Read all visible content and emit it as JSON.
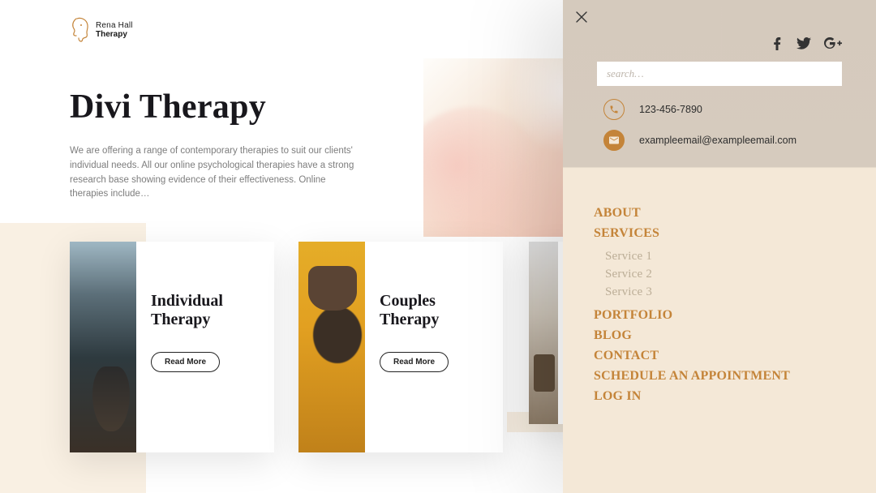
{
  "logo": {
    "name": "Rena Hall",
    "sub": "Therapy"
  },
  "hero": {
    "title": "Divi Therapy",
    "intro": "We are offering a range of contemporary therapies to suit our clients' individual needs. All our online psychological therapies have a strong research base showing evidence of their effectiveness. Online therapies include…"
  },
  "cards": [
    {
      "title": "Individual Therapy",
      "cta": "Read More"
    },
    {
      "title": "Couples Therapy",
      "cta": "Read More"
    }
  ],
  "panel": {
    "search_placeholder": "search…",
    "phone": "123-456-7890",
    "email": "exampleemail@exampleemail.com",
    "nav": {
      "about": "ABOUT",
      "services": "SERVICES",
      "service_items": [
        "Service 1",
        "Service 2",
        "Service 3"
      ],
      "portfolio": "PORTFOLIO",
      "blog": "BLOG",
      "contact": "CONTACT",
      "schedule": "SCHEDULE AN APPOINTMENT",
      "login": "LOG IN"
    }
  }
}
